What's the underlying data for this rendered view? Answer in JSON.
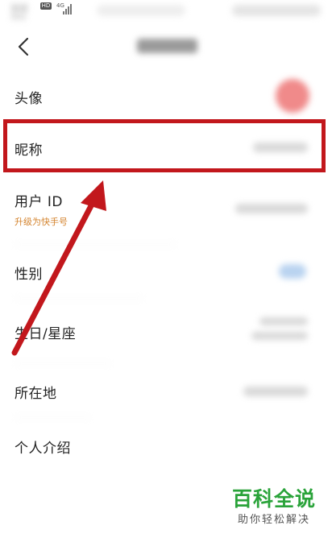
{
  "status_bar": {
    "carrier": "联通",
    "carrier_sub": "移动",
    "hd_badge": "HD",
    "signal_type": "4G"
  },
  "header": {
    "back_icon": "chevron-left-icon"
  },
  "rows": [
    {
      "label": "头像"
    },
    {
      "label": "昵称"
    },
    {
      "label": "用户 ID",
      "sub": "升级为快手号"
    },
    {
      "label": "性别"
    },
    {
      "label": "生日/星座"
    },
    {
      "label": "所在地"
    },
    {
      "label": "个人介绍"
    }
  ],
  "annotation": {
    "color": "#c2171c"
  },
  "watermark": {
    "title": "百科全说",
    "subtitle": "助你轻松解决",
    "color": "#2aa33a"
  }
}
